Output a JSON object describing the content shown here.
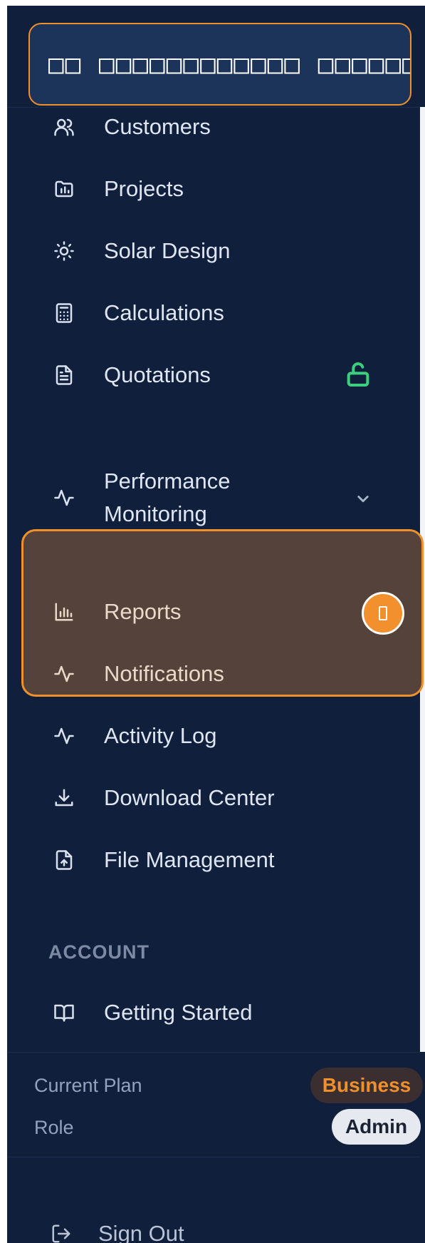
{
  "header": {
    "title": "□□ □□□□□□□□□□□□ □□□□□□□□□"
  },
  "nav": {
    "items": [
      {
        "label": "Customers",
        "icon": "users-icon"
      },
      {
        "label": "Projects",
        "icon": "folder-chart-icon"
      },
      {
        "label": "Solar Design",
        "icon": "sun-icon"
      },
      {
        "label": "Calculations",
        "icon": "calculator-icon"
      },
      {
        "label": "Quotations",
        "icon": "file-text-icon"
      }
    ],
    "quotations_lock_icon": "unlock-icon",
    "performance": {
      "label": "Performance Monitoring",
      "icon": "activity-icon",
      "expanded": true
    },
    "sub_items": [
      {
        "label": "Reports",
        "icon": "bar-chart-icon"
      },
      {
        "label": "Notifications",
        "icon": "activity-icon"
      }
    ],
    "more_items": [
      {
        "label": "Activity Log",
        "icon": "activity-icon"
      },
      {
        "label": "Download Center",
        "icon": "download-icon"
      },
      {
        "label": "File Management",
        "icon": "file-upload-icon"
      }
    ]
  },
  "account": {
    "heading": "ACCOUNT",
    "items": [
      {
        "label": "Getting Started",
        "icon": "book-open-icon"
      }
    ]
  },
  "footer": {
    "plan_label": "Current Plan",
    "plan_value": "Business",
    "role_label": "Role",
    "role_value": "Admin",
    "signout_label": "Sign Out"
  },
  "colors": {
    "sidebar_bg": "#0f1f3c",
    "accent": "#f0902a",
    "lock_green": "#3ecf7d",
    "highlight_bg": "#55423a"
  }
}
